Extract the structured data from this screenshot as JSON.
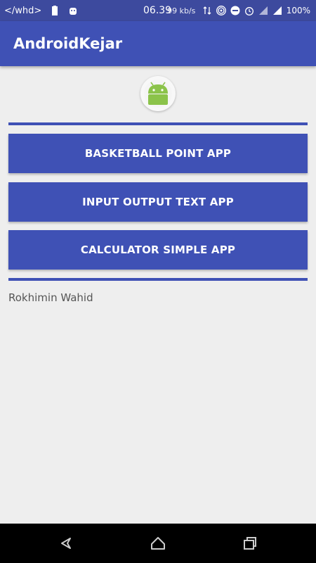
{
  "status_bar": {
    "left_text": "</whd>",
    "time": "06.39",
    "speed": "99 kb/s",
    "battery": "100%"
  },
  "app_bar": {
    "title": "AndroidKejar"
  },
  "buttons": [
    {
      "label": "BASKETBALL POINT APP"
    },
    {
      "label": "INPUT OUTPUT TEXT APP"
    },
    {
      "label": "CALCULATOR SIMPLE APP"
    }
  ],
  "author": "Rokhimin Wahid",
  "colors": {
    "primary": "#3f51b5",
    "status_bar": "#3d4a9e",
    "background": "#eeeeee",
    "android_green": "#a4c639"
  },
  "icons": [
    "battery-icon",
    "android-notification-icon",
    "data-arrows-icon",
    "hotspot-icon",
    "dnd-icon",
    "alarm-icon",
    "signal-h-icon",
    "signal-icon",
    "android-logo-icon",
    "back-icon",
    "home-icon",
    "recents-icon"
  ]
}
